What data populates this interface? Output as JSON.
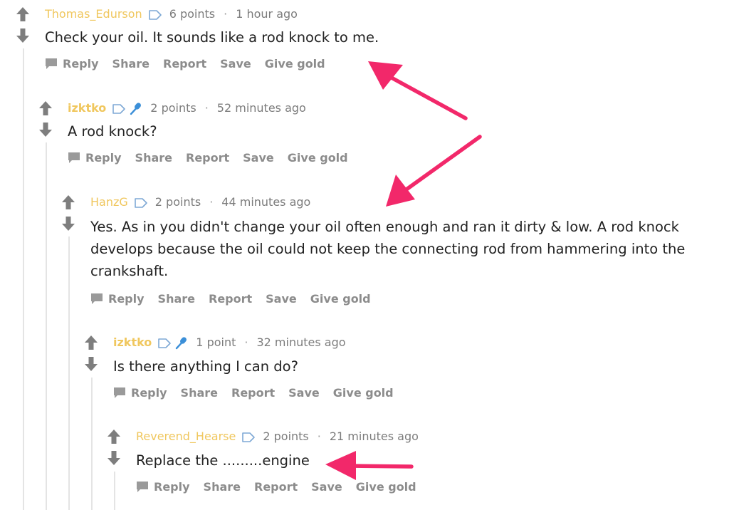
{
  "actions": {
    "reply": "Reply",
    "share": "Share",
    "report": "Report",
    "save": "Save",
    "give_gold": "Give gold"
  },
  "comments": [
    {
      "author": "Thomas_Edurson",
      "points": "6 points",
      "separator": "·",
      "time": "1 hour ago",
      "body": "Check your oil. It sounds like a rod knock to me."
    },
    {
      "author": "izktko",
      "points": "2 points",
      "separator": "·",
      "time": "52 minutes ago",
      "body": "A rod knock?"
    },
    {
      "author": "HanzG",
      "points": "2 points",
      "separator": "·",
      "time": "44 minutes ago",
      "body": "Yes. As in you didn't change your oil often enough and ran it dirty & low. A rod knock develops because the oil could not keep the connecting rod from hammering into the crankshaft."
    },
    {
      "author": "izktko",
      "points": "1 point",
      "separator": "·",
      "time": "32 minutes ago",
      "body": "Is there anything I can do?"
    },
    {
      "author": "Reverend_Hearse",
      "points": "2 points",
      "separator": "·",
      "time": "21 minutes ago",
      "body": "Replace the .........engine"
    }
  ],
  "icons": {
    "upvote": "upvote-arrow-icon",
    "downvote": "downvote-arrow-icon",
    "flair": "flair-tag-icon",
    "mic": "microphone-icon",
    "reply": "speech-bubble-icon",
    "annotation": "pink-arrow-icon"
  },
  "colors": {
    "author": "#f0c75e",
    "meta": "#7c7c7c",
    "action": "#8c8c8c",
    "vote_arrow": "#7e7e7e",
    "flair": "#7fa9d6",
    "mic": "#3b8fd8",
    "rail": "#e4e4e4",
    "annotation_arrow": "#f2286a"
  }
}
